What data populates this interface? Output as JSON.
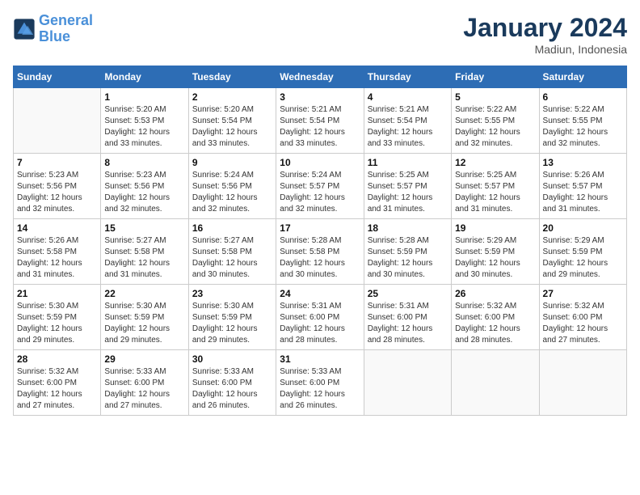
{
  "header": {
    "logo_general": "General",
    "logo_blue": "Blue",
    "month_title": "January 2024",
    "location": "Madiun, Indonesia"
  },
  "days_of_week": [
    "Sunday",
    "Monday",
    "Tuesday",
    "Wednesday",
    "Thursday",
    "Friday",
    "Saturday"
  ],
  "weeks": [
    [
      {
        "day": "",
        "detail": ""
      },
      {
        "day": "1",
        "detail": "Sunrise: 5:20 AM\nSunset: 5:53 PM\nDaylight: 12 hours\nand 33 minutes."
      },
      {
        "day": "2",
        "detail": "Sunrise: 5:20 AM\nSunset: 5:54 PM\nDaylight: 12 hours\nand 33 minutes."
      },
      {
        "day": "3",
        "detail": "Sunrise: 5:21 AM\nSunset: 5:54 PM\nDaylight: 12 hours\nand 33 minutes."
      },
      {
        "day": "4",
        "detail": "Sunrise: 5:21 AM\nSunset: 5:54 PM\nDaylight: 12 hours\nand 33 minutes."
      },
      {
        "day": "5",
        "detail": "Sunrise: 5:22 AM\nSunset: 5:55 PM\nDaylight: 12 hours\nand 32 minutes."
      },
      {
        "day": "6",
        "detail": "Sunrise: 5:22 AM\nSunset: 5:55 PM\nDaylight: 12 hours\nand 32 minutes."
      }
    ],
    [
      {
        "day": "7",
        "detail": "Sunrise: 5:23 AM\nSunset: 5:56 PM\nDaylight: 12 hours\nand 32 minutes."
      },
      {
        "day": "8",
        "detail": "Sunrise: 5:23 AM\nSunset: 5:56 PM\nDaylight: 12 hours\nand 32 minutes."
      },
      {
        "day": "9",
        "detail": "Sunrise: 5:24 AM\nSunset: 5:56 PM\nDaylight: 12 hours\nand 32 minutes."
      },
      {
        "day": "10",
        "detail": "Sunrise: 5:24 AM\nSunset: 5:57 PM\nDaylight: 12 hours\nand 32 minutes."
      },
      {
        "day": "11",
        "detail": "Sunrise: 5:25 AM\nSunset: 5:57 PM\nDaylight: 12 hours\nand 31 minutes."
      },
      {
        "day": "12",
        "detail": "Sunrise: 5:25 AM\nSunset: 5:57 PM\nDaylight: 12 hours\nand 31 minutes."
      },
      {
        "day": "13",
        "detail": "Sunrise: 5:26 AM\nSunset: 5:57 PM\nDaylight: 12 hours\nand 31 minutes."
      }
    ],
    [
      {
        "day": "14",
        "detail": "Sunrise: 5:26 AM\nSunset: 5:58 PM\nDaylight: 12 hours\nand 31 minutes."
      },
      {
        "day": "15",
        "detail": "Sunrise: 5:27 AM\nSunset: 5:58 PM\nDaylight: 12 hours\nand 31 minutes."
      },
      {
        "day": "16",
        "detail": "Sunrise: 5:27 AM\nSunset: 5:58 PM\nDaylight: 12 hours\nand 30 minutes."
      },
      {
        "day": "17",
        "detail": "Sunrise: 5:28 AM\nSunset: 5:58 PM\nDaylight: 12 hours\nand 30 minutes."
      },
      {
        "day": "18",
        "detail": "Sunrise: 5:28 AM\nSunset: 5:59 PM\nDaylight: 12 hours\nand 30 minutes."
      },
      {
        "day": "19",
        "detail": "Sunrise: 5:29 AM\nSunset: 5:59 PM\nDaylight: 12 hours\nand 30 minutes."
      },
      {
        "day": "20",
        "detail": "Sunrise: 5:29 AM\nSunset: 5:59 PM\nDaylight: 12 hours\nand 29 minutes."
      }
    ],
    [
      {
        "day": "21",
        "detail": "Sunrise: 5:30 AM\nSunset: 5:59 PM\nDaylight: 12 hours\nand 29 minutes."
      },
      {
        "day": "22",
        "detail": "Sunrise: 5:30 AM\nSunset: 5:59 PM\nDaylight: 12 hours\nand 29 minutes."
      },
      {
        "day": "23",
        "detail": "Sunrise: 5:30 AM\nSunset: 5:59 PM\nDaylight: 12 hours\nand 29 minutes."
      },
      {
        "day": "24",
        "detail": "Sunrise: 5:31 AM\nSunset: 6:00 PM\nDaylight: 12 hours\nand 28 minutes."
      },
      {
        "day": "25",
        "detail": "Sunrise: 5:31 AM\nSunset: 6:00 PM\nDaylight: 12 hours\nand 28 minutes."
      },
      {
        "day": "26",
        "detail": "Sunrise: 5:32 AM\nSunset: 6:00 PM\nDaylight: 12 hours\nand 28 minutes."
      },
      {
        "day": "27",
        "detail": "Sunrise: 5:32 AM\nSunset: 6:00 PM\nDaylight: 12 hours\nand 27 minutes."
      }
    ],
    [
      {
        "day": "28",
        "detail": "Sunrise: 5:32 AM\nSunset: 6:00 PM\nDaylight: 12 hours\nand 27 minutes."
      },
      {
        "day": "29",
        "detail": "Sunrise: 5:33 AM\nSunset: 6:00 PM\nDaylight: 12 hours\nand 27 minutes."
      },
      {
        "day": "30",
        "detail": "Sunrise: 5:33 AM\nSunset: 6:00 PM\nDaylight: 12 hours\nand 26 minutes."
      },
      {
        "day": "31",
        "detail": "Sunrise: 5:33 AM\nSunset: 6:00 PM\nDaylight: 12 hours\nand 26 minutes."
      },
      {
        "day": "",
        "detail": ""
      },
      {
        "day": "",
        "detail": ""
      },
      {
        "day": "",
        "detail": ""
      }
    ]
  ]
}
